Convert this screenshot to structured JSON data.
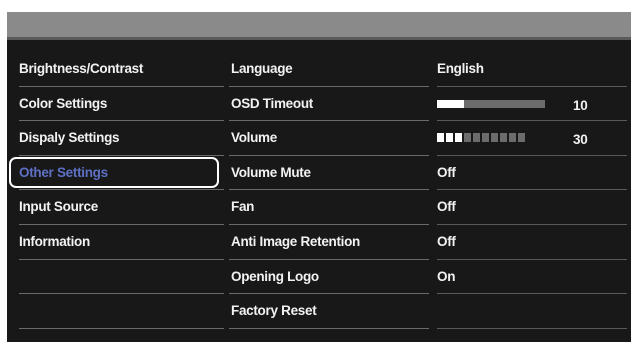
{
  "menu": {
    "items": [
      {
        "label": "Brightness/Contrast",
        "selected": false
      },
      {
        "label": "Color Settings",
        "selected": false
      },
      {
        "label": "Dispaly Settings",
        "selected": false
      },
      {
        "label": "Other Settings",
        "selected": true
      },
      {
        "label": "Input Source",
        "selected": false
      },
      {
        "label": "Information",
        "selected": false
      },
      {
        "label": "",
        "selected": false
      },
      {
        "label": "",
        "selected": false
      }
    ]
  },
  "settings": {
    "items": [
      {
        "label": "Language",
        "value": "English",
        "type": "text"
      },
      {
        "label": "OSD Timeout",
        "value": "10",
        "type": "bar",
        "level": 0.25
      },
      {
        "label": "Volume",
        "value": "30",
        "type": "segments",
        "segments_on": 3,
        "segments_total": 10
      },
      {
        "label": "Volume Mute",
        "value": "Off",
        "type": "text"
      },
      {
        "label": "Fan",
        "value": "Off",
        "type": "text"
      },
      {
        "label": "Anti Image Retention",
        "value": "Off",
        "type": "text"
      },
      {
        "label": "Opening Logo",
        "value": "On",
        "type": "text"
      },
      {
        "label": "Factory Reset",
        "value": "",
        "type": "text"
      }
    ]
  },
  "colors": {
    "panel_background": "#181818",
    "header_bar": "#8a8a8a",
    "selected_text": "#5d70c4",
    "text": "#f2f2f2"
  }
}
